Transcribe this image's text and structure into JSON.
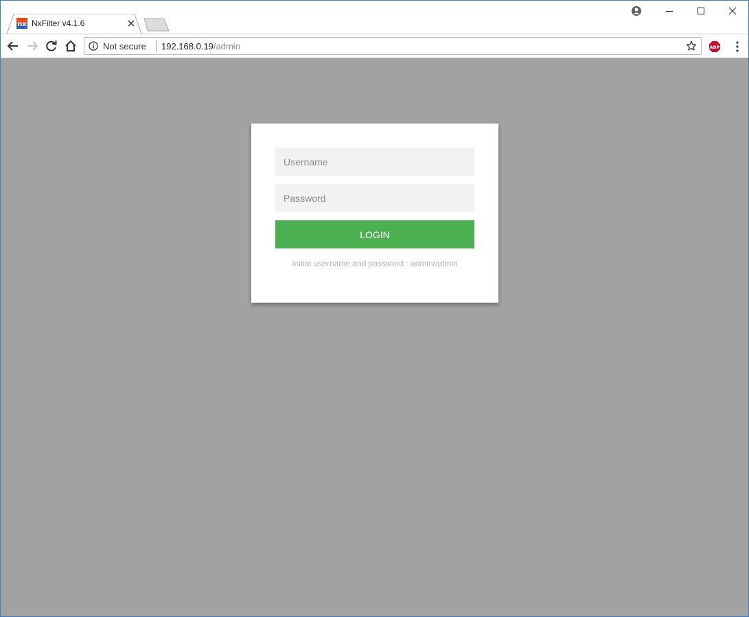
{
  "browser": {
    "tab": {
      "title": "NxFilter v4.1.6",
      "favicon_text": "nx",
      "favicon_colors": [
        "#e84a1c",
        "#2b5fb8"
      ]
    },
    "address_bar": {
      "security_label": "Not secure",
      "url_host": "192.168.0.19",
      "url_path": "/admin"
    },
    "extension_badge": "ABP"
  },
  "login": {
    "username_placeholder": "Username",
    "password_placeholder": "Password",
    "button_label": "LOGIN",
    "hint": "Initial username and password : admin/admin"
  },
  "colors": {
    "page_background": "#a2a2a2",
    "card_background": "#ffffff",
    "field_background": "#f2f2f2",
    "login_button": "#4caf50",
    "hint_text": "#b3b3b3"
  }
}
